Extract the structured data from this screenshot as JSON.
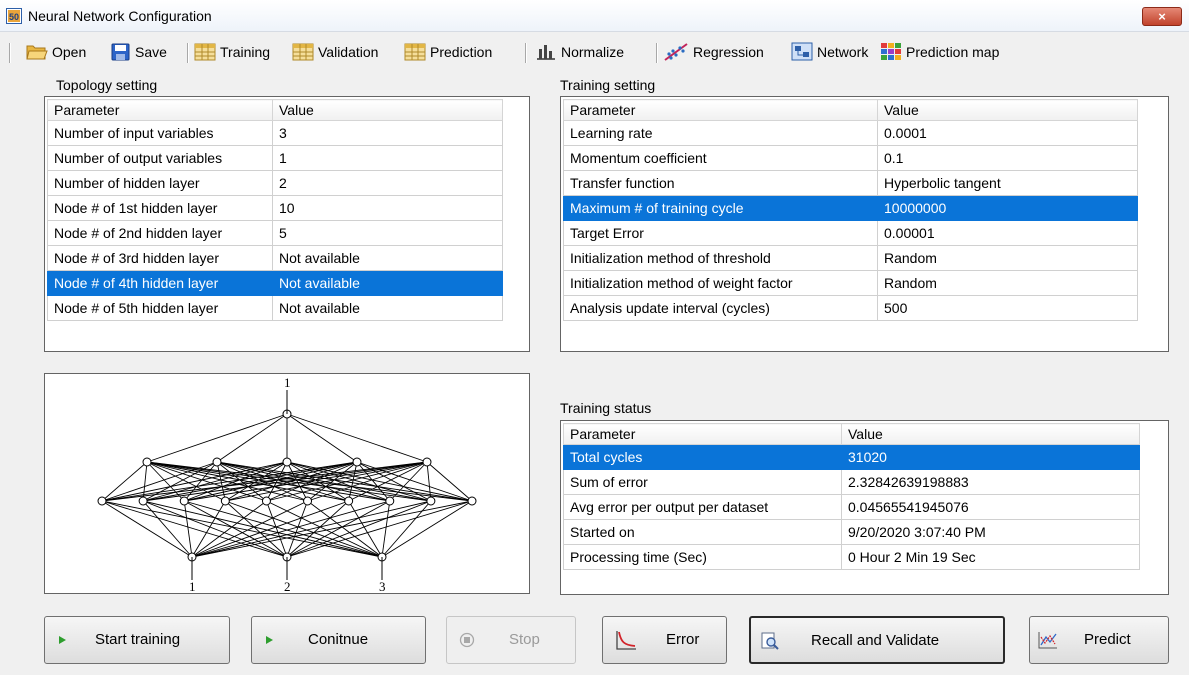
{
  "window": {
    "title": "Neural Network Configuration",
    "close_label": "×",
    "app_icon": "neural-app-icon"
  },
  "toolbar": {
    "items": [
      {
        "label": "Open",
        "icon": "folder-icon"
      },
      {
        "label": "Save",
        "icon": "floppy-icon"
      },
      {
        "label": "Training",
        "icon": "table-icon"
      },
      {
        "label": "Validation",
        "icon": "table-icon"
      },
      {
        "label": "Prediction",
        "icon": "table-icon"
      },
      {
        "label": "Normalize",
        "icon": "bar-chart-icon"
      },
      {
        "label": "Regression",
        "icon": "regression-icon"
      },
      {
        "label": "Network",
        "icon": "network-icon"
      },
      {
        "label": "Prediction map",
        "icon": "color-grid-icon"
      }
    ]
  },
  "topology": {
    "label": "Topology setting",
    "headers": [
      "Parameter",
      "Value"
    ],
    "rows": [
      [
        "Number of input variables",
        "3"
      ],
      [
        "Number of output variables",
        "1"
      ],
      [
        "Number of hidden layer",
        "2"
      ],
      [
        "Node # of 1st hidden layer",
        "10"
      ],
      [
        "Node # of 2nd hidden layer",
        "5"
      ],
      [
        "Node # of 3rd hidden layer",
        "Not available"
      ],
      [
        "Node # of 4th hidden layer",
        "Not available"
      ],
      [
        "Node # of 5th hidden layer",
        "Not available"
      ]
    ],
    "selected_row": 6
  },
  "training_setting": {
    "label": "Training setting",
    "headers": [
      "Parameter",
      "Value"
    ],
    "rows": [
      [
        "Learning rate",
        "0.0001"
      ],
      [
        "Momentum coefficient",
        "0.1"
      ],
      [
        "Transfer function",
        "Hyperbolic tangent"
      ],
      [
        "Maximum # of training cycle",
        "10000000"
      ],
      [
        "Target Error",
        "0.00001"
      ],
      [
        "Initialization method of threshold",
        "Random"
      ],
      [
        "Initialization method of weight factor",
        "Random"
      ],
      [
        "Analysis update interval (cycles)",
        "500"
      ]
    ],
    "selected_row": 3
  },
  "training_status": {
    "label": "Training status",
    "headers": [
      "Parameter",
      "Value"
    ],
    "rows": [
      [
        "Total cycles",
        "31020"
      ],
      [
        "Sum of error",
        "2.32842639198883"
      ],
      [
        "Avg error per output per dataset",
        "0.04565541945076"
      ],
      [
        "Started on",
        "9/20/2020 3:07:40 PM"
      ],
      [
        "Processing time (Sec)",
        "0 Hour  2 Min  19 Sec"
      ]
    ],
    "selected_row": 0
  },
  "network": {
    "layers": [
      3,
      10,
      5,
      1
    ],
    "input_labels": [
      "1",
      "2",
      "3"
    ],
    "output_labels": [
      "1"
    ]
  },
  "buttons": {
    "start": "Start training",
    "continue": "Conitnue",
    "stop": "Stop",
    "error": "Error",
    "recall": "Recall and Validate",
    "predict": "Predict"
  },
  "colors": {
    "selection": "#0a74d8",
    "play_icon": "#2e9e2e"
  }
}
